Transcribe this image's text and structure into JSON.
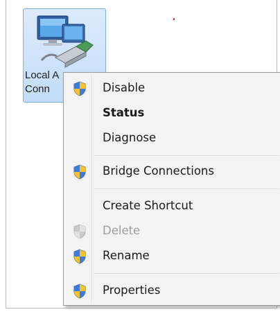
{
  "desktop_icon": {
    "label_line1": "Local A",
    "label_line2": "Conn"
  },
  "context_menu": {
    "items": [
      {
        "label": "Disable",
        "shield": true,
        "state": "normal"
      },
      {
        "label": "Status",
        "shield": false,
        "state": "default"
      },
      {
        "label": "Diagnose",
        "shield": false,
        "state": "normal"
      },
      {
        "label": "Bridge Connections",
        "shield": true,
        "state": "normal"
      },
      {
        "label": "Create Shortcut",
        "shield": false,
        "state": "normal"
      },
      {
        "label": "Delete",
        "shield": true,
        "state": "disabled"
      },
      {
        "label": "Rename",
        "shield": true,
        "state": "normal"
      },
      {
        "label": "Properties",
        "shield": true,
        "state": "normal"
      }
    ]
  },
  "colors": {
    "shield_blue": "#2b63c6",
    "shield_yellow": "#f2c230",
    "disabled_gray": "#9d9d9d",
    "selection_blue": "#c3dcf8"
  }
}
